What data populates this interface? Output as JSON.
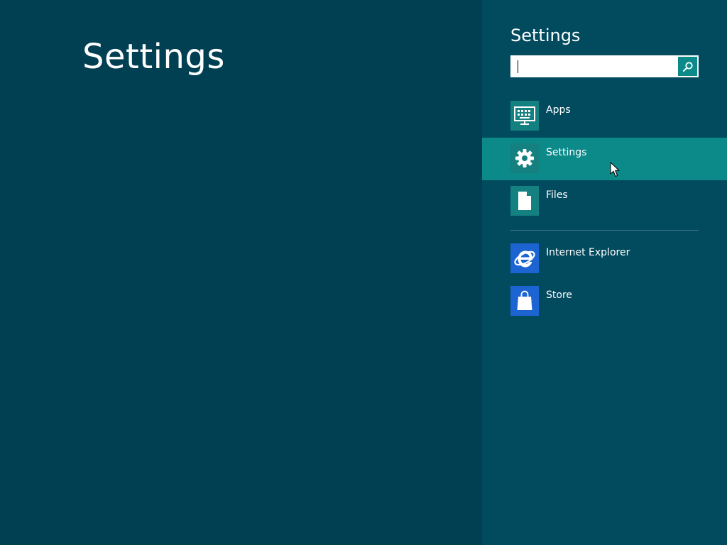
{
  "main": {
    "title": "Settings"
  },
  "charm": {
    "title": "Settings",
    "search": {
      "value": "",
      "placeholder": ""
    },
    "items": [
      {
        "label": "Apps",
        "icon": "apps-monitor-icon",
        "selected": false
      },
      {
        "label": "Settings",
        "icon": "gear-icon",
        "selected": true
      },
      {
        "label": "Files",
        "icon": "document-icon",
        "selected": false
      },
      {
        "label": "Internet Explorer",
        "icon": "internet-explorer-icon",
        "selected": false
      },
      {
        "label": "Store",
        "icon": "store-bag-icon",
        "selected": false
      }
    ]
  },
  "colors": {
    "background": "#013f53",
    "charm_background": "#024a5e",
    "accent": "#0b8a89",
    "tile_teal": "#14807f",
    "tile_blue": "#1c64d2"
  }
}
